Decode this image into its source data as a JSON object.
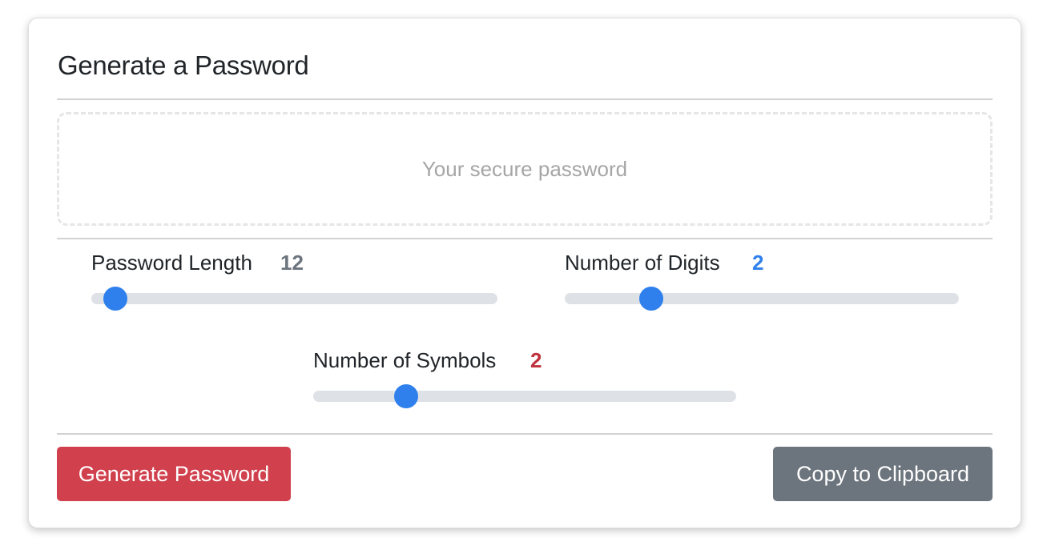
{
  "title": "Generate a Password",
  "password_placeholder": "Your secure password",
  "controls": {
    "length": {
      "label": "Password Length",
      "value": "12",
      "value_color": "#6c757d",
      "fraction": 0.06
    },
    "digits": {
      "label": "Number of Digits",
      "value": "2",
      "value_color": "#2f80ed",
      "fraction": 0.22
    },
    "symbols": {
      "label": "Number of Symbols",
      "value": "2",
      "value_color": "#c0313c",
      "fraction": 0.22
    }
  },
  "buttons": {
    "generate": "Generate Password",
    "copy": "Copy to Clipboard"
  },
  "colors": {
    "accent": "#2f80ed",
    "generate_bg": "#d0414d",
    "copy_bg": "#6c757d"
  }
}
